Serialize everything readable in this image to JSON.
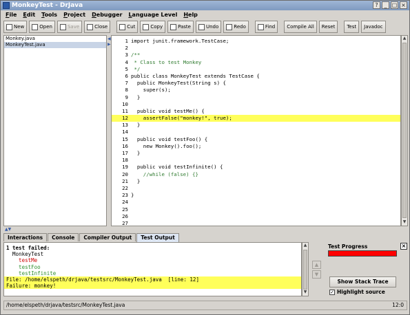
{
  "window": {
    "title": "MonkeyTest - DrJava"
  },
  "menu": [
    "File",
    "Edit",
    "Tools",
    "Project",
    "Debugger",
    "Language Level",
    "Help"
  ],
  "toolbar": [
    {
      "label": "New",
      "icon": "new-file-icon"
    },
    {
      "label": "Open",
      "icon": "open-folder-icon"
    },
    {
      "label": "Save",
      "icon": "save-icon",
      "disabled": true
    },
    {
      "label": "Close",
      "icon": "close-file-icon"
    },
    {
      "label": "Cut",
      "icon": "scissors-icon"
    },
    {
      "label": "Copy",
      "icon": "copy-icon"
    },
    {
      "label": "Paste",
      "icon": "paste-icon"
    },
    {
      "label": "Undo",
      "icon": "undo-icon"
    },
    {
      "label": "Redo",
      "icon": "redo-icon"
    },
    {
      "label": "Find",
      "icon": "find-icon"
    },
    {
      "label": "Compile All"
    },
    {
      "label": "Reset"
    },
    {
      "label": "Test"
    },
    {
      "label": "Javadoc"
    }
  ],
  "files": [
    {
      "name": "Monkey.java",
      "selected": false
    },
    {
      "name": "MonkeyTest.java",
      "selected": true
    }
  ],
  "editor": {
    "lines": [
      {
        "n": "1",
        "text": "import junit.framework.TestCase;"
      },
      {
        "n": "2",
        "text": ""
      },
      {
        "n": "3",
        "text": "/**",
        "cls": "comment"
      },
      {
        "n": "4",
        "text": " * Class to test Monkey",
        "cls": "comment"
      },
      {
        "n": "5",
        "text": " */",
        "cls": "comment"
      },
      {
        "n": "6",
        "text": "public class MonkeyTest extends TestCase {"
      },
      {
        "n": "7",
        "text": "  public MonkeyTest(String s) {"
      },
      {
        "n": "8",
        "text": "    super(s);"
      },
      {
        "n": "9",
        "text": "  }"
      },
      {
        "n": "10",
        "text": ""
      },
      {
        "n": "11",
        "text": "  public void testMe() {"
      },
      {
        "n": "12",
        "text": "    assertFalse(\"monkey!\", true);",
        "hl": true
      },
      {
        "n": "13",
        "text": "  }"
      },
      {
        "n": "14",
        "text": ""
      },
      {
        "n": "15",
        "text": "  public void testFoo() {"
      },
      {
        "n": "16",
        "text": "    new Monkey().foo();"
      },
      {
        "n": "17",
        "text": "  }"
      },
      {
        "n": "18",
        "text": ""
      },
      {
        "n": "19",
        "text": "  public void testInfinite() {"
      },
      {
        "n": "20",
        "text": "    //while (false) {}",
        "cls": "comment"
      },
      {
        "n": "21",
        "text": "  }"
      },
      {
        "n": "22",
        "text": ""
      },
      {
        "n": "23",
        "text": "}"
      },
      {
        "n": "24",
        "text": ""
      },
      {
        "n": "25",
        "text": ""
      },
      {
        "n": "26",
        "text": ""
      },
      {
        "n": "27",
        "text": ""
      }
    ]
  },
  "tabs": [
    {
      "label": "Interactions",
      "active": false
    },
    {
      "label": "Console",
      "active": false
    },
    {
      "label": "Compiler Output",
      "active": false
    },
    {
      "label": "Test Output",
      "active": true
    }
  ],
  "output": {
    "lines": [
      {
        "text": "1 test failed:",
        "bold": true
      },
      {
        "text": "  MonkeyTest"
      },
      {
        "text": "    testMe",
        "cls": "red"
      },
      {
        "text": "    testFoo",
        "cls": "green"
      },
      {
        "text": "    testInfinite",
        "cls": "green"
      },
      {
        "text": "File: /home/elspeth/drjava/testsrc/MonkeyTest.java  [line: 12]",
        "hl": true
      },
      {
        "text": "Failure: monkey!",
        "hl": true
      }
    ]
  },
  "test_panel": {
    "progress_label": "Test Progress",
    "progress_fraction": 1.0,
    "progress_color": "#ff0000",
    "stack_trace_button": "Show Stack Trace",
    "highlight_label": "Highlight source",
    "highlight_checked": true
  },
  "status": {
    "path": "/home/elspeth/drjava/testsrc/MonkeyTest.java",
    "position": "12:0"
  }
}
